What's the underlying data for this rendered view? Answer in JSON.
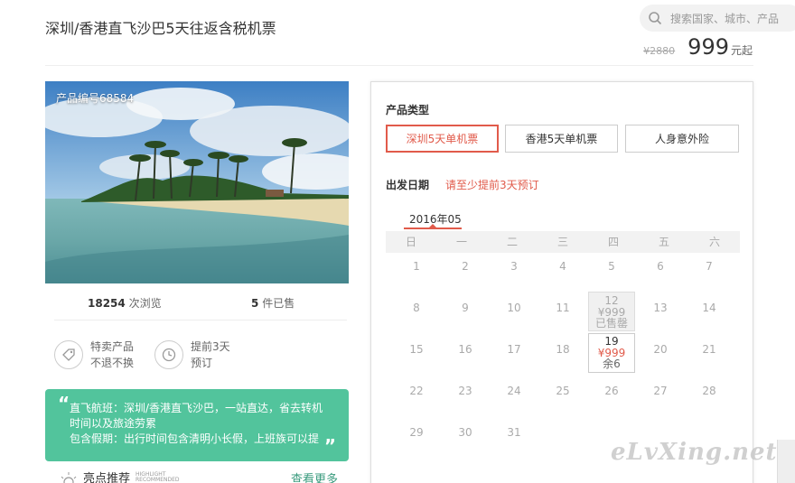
{
  "header": {
    "title": "深圳/香港直飞沙巴5天往返含税机票",
    "search_placeholder": "搜索国家、城市、产品",
    "old_price": "¥2880",
    "price": "999",
    "price_suffix": "元起"
  },
  "product": {
    "code": "产品编号68584",
    "views_count": "18254",
    "views_label": "次浏览",
    "sold_count": "5",
    "sold_label": "件已售"
  },
  "features": [
    {
      "line1": "特卖产品",
      "line2": "不退不换",
      "icon": "tag-icon"
    },
    {
      "line1": "提前3天",
      "line2": "预订",
      "icon": "clock-icon"
    }
  ],
  "note": {
    "lines": [
      "直飞航班：深圳/香港直飞沙巴，一站直达，省去转机",
      "时间以及旅途劳累",
      "包含假期：出行时间包含清明小长假，上班族可以提"
    ]
  },
  "highlights": {
    "label": "亮点推荐",
    "en1": "HIGHLIGHT",
    "en2": "RECOMMENDED",
    "more": "查看更多"
  },
  "booking": {
    "type_label": "产品类型",
    "options": [
      "深圳5天单机票",
      "香港5天单机票",
      "人身意外险"
    ],
    "date_label": "出发日期",
    "date_hint": "请至少提前3天预订",
    "month": "2016年05",
    "weekdays": [
      "日",
      "一",
      "二",
      "三",
      "四",
      "五",
      "六"
    ],
    "sold_day": {
      "day": "12",
      "price": "¥999",
      "status": "已售罄"
    },
    "avail_day": {
      "day": "19",
      "price": "¥999",
      "status": "余6"
    }
  },
  "watermark": "eLvXing.net"
}
